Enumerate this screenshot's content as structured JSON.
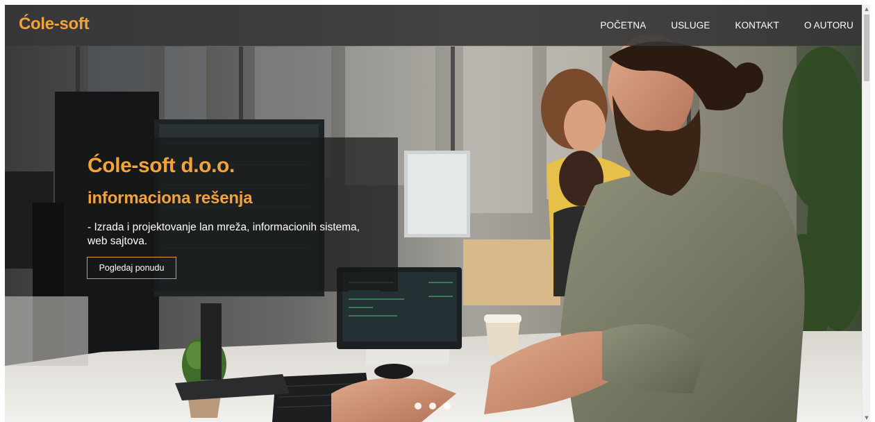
{
  "navbar": {
    "brand": "Ćole-soft",
    "items": [
      {
        "label": "POČETNA"
      },
      {
        "label": "USLUGE"
      },
      {
        "label": "KONTAKT"
      },
      {
        "label": "O AUTORU"
      }
    ]
  },
  "hero": {
    "title": "Ćole-soft d.o.o.",
    "subtitle": "informaciona rešenja",
    "description": "- Izrada i projektovanje lan mreža, informacionih sistema, web sajtova.",
    "cta_label": "Pogledaj ponudu",
    "background_image": "office workers at computers photo"
  },
  "carousel": {
    "slide_count": 3,
    "active_index": 0
  },
  "colors": {
    "accent": "#f2a33a",
    "navbar_bg": "#373737",
    "caption_bg": "#181818",
    "text": "#ffffff"
  },
  "scrollbar": {
    "up_icon": "▲",
    "down_icon": "▼"
  }
}
